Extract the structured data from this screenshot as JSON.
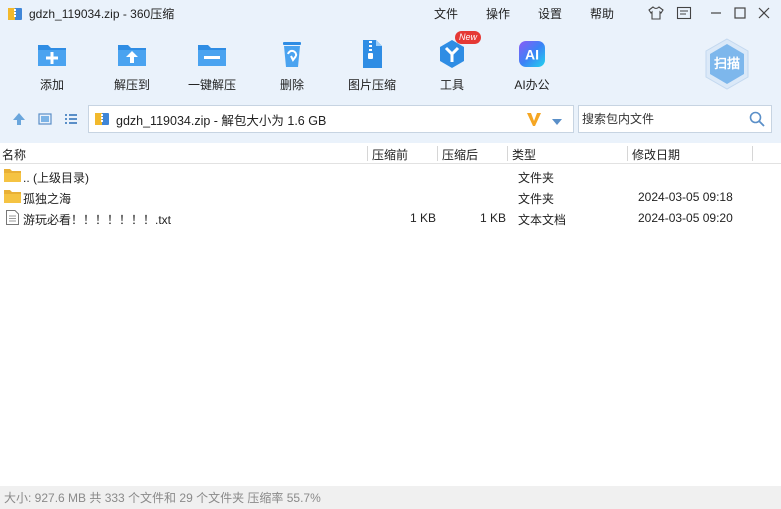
{
  "window": {
    "title": "gdzh_119034.zip - 360压缩",
    "menu": [
      "文件",
      "操作",
      "设置",
      "帮助"
    ]
  },
  "toolbar": {
    "items": [
      {
        "label": "添加",
        "icon": "add-icon"
      },
      {
        "label": "解压到",
        "icon": "extract-to-icon"
      },
      {
        "label": "一键解压",
        "icon": "one-click-extract-icon"
      },
      {
        "label": "删除",
        "icon": "delete-icon"
      },
      {
        "label": "图片压缩",
        "icon": "image-compress-icon"
      },
      {
        "label": "工具",
        "icon": "tools-icon",
        "badge": "New"
      },
      {
        "label": "AI办公",
        "icon": "ai-office-icon",
        "icon_text": "AI"
      }
    ],
    "scan_label": "扫描"
  },
  "address": {
    "path": "gdzh_119034.zip - 解包大小为 1.6 GB",
    "search_placeholder": "搜索包内文件"
  },
  "columns": {
    "name": "名称",
    "compressed": "压缩前",
    "after": "压缩后",
    "type": "类型",
    "modified": "修改日期"
  },
  "files": [
    {
      "name": ".. (上级目录)",
      "compressed": "",
      "after": "",
      "type": "文件夹",
      "modified": "",
      "kind": "folder"
    },
    {
      "name": "孤独之海",
      "compressed": "",
      "after": "",
      "type": "文件夹",
      "modified": "2024-03-05 09:18",
      "kind": "folder"
    },
    {
      "name": "游玩必看！！！！！！！.txt",
      "compressed": "1 KB",
      "after": "1 KB",
      "type": "文本文档",
      "modified": "2024-03-05 09:20",
      "kind": "text"
    }
  ],
  "status": "大小: 927.6 MB 共 333 个文件和 29 个文件夹 压缩率 55.7%",
  "colors": {
    "accent": "#2f8de4",
    "background": "#eaf2fb",
    "folder": "#f5c342"
  }
}
